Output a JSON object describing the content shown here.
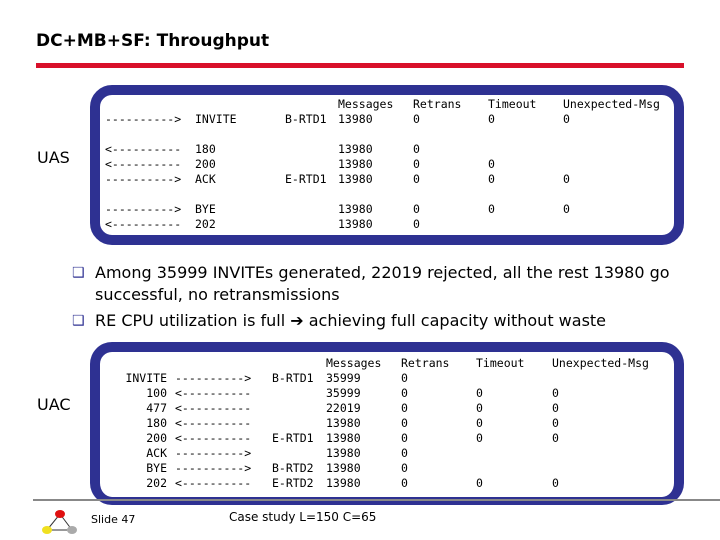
{
  "title": "DC+MB+SF: Throughput",
  "uas": {
    "label": "UAS",
    "header": [
      "Messages",
      "Retrans",
      "Timeout",
      "Unexpected-Msg"
    ],
    "rows": [
      {
        "arrow": "---------->",
        "msg": "INVITE",
        "rtd": "B-RTD1",
        "messages": "13980",
        "retrans": "0",
        "timeout": "0",
        "unexpected": "0"
      },
      {
        "arrow": "<----------",
        "msg": "180",
        "rtd": "",
        "messages": "13980",
        "retrans": "0",
        "timeout": "",
        "unexpected": ""
      },
      {
        "arrow": "<----------",
        "msg": "200",
        "rtd": "",
        "messages": "13980",
        "retrans": "0",
        "timeout": "0",
        "unexpected": ""
      },
      {
        "arrow": "---------->",
        "msg": "ACK",
        "rtd": "E-RTD1",
        "messages": "13980",
        "retrans": "0",
        "timeout": "0",
        "unexpected": "0"
      },
      {
        "arrow": "---------->",
        "msg": "BYE",
        "rtd": "",
        "messages": "13980",
        "retrans": "0",
        "timeout": "0",
        "unexpected": "0"
      },
      {
        "arrow": "<----------",
        "msg": "202",
        "rtd": "",
        "messages": "13980",
        "retrans": "0",
        "timeout": "",
        "unexpected": ""
      }
    ]
  },
  "bullets": [
    "Among 35999 INVITEs generated, 22019 rejected, all the rest 13980 go successful, no retransmissions",
    "RE CPU utilization is full ➔ achieving full capacity without waste"
  ],
  "uac": {
    "label": "UAC",
    "header": [
      "Messages",
      "Retrans",
      "Timeout",
      "Unexpected-Msg"
    ],
    "rows": [
      {
        "msg": "INVITE",
        "arrow": "---------->",
        "rtd": "B-RTD1",
        "messages": "35999",
        "retrans": "0",
        "timeout": "",
        "unexpected": ""
      },
      {
        "msg": "100",
        "arrow": "<----------",
        "rtd": "",
        "messages": "35999",
        "retrans": "0",
        "timeout": "0",
        "unexpected": "0"
      },
      {
        "msg": "477",
        "arrow": "<----------",
        "rtd": "",
        "messages": "22019",
        "retrans": "0",
        "timeout": "0",
        "unexpected": "0"
      },
      {
        "msg": "180",
        "arrow": "<----------",
        "rtd": "",
        "messages": "13980",
        "retrans": "0",
        "timeout": "0",
        "unexpected": "0"
      },
      {
        "msg": "200",
        "arrow": "<----------",
        "rtd": "E-RTD1",
        "messages": "13980",
        "retrans": "0",
        "timeout": "0",
        "unexpected": "0"
      },
      {
        "msg": "ACK",
        "arrow": "---------->",
        "rtd": "",
        "messages": "13980",
        "retrans": "0",
        "timeout": "",
        "unexpected": ""
      },
      {
        "msg": "BYE",
        "arrow": "---------->",
        "rtd": "B-RTD2",
        "messages": "13980",
        "retrans": "0",
        "timeout": "",
        "unexpected": ""
      },
      {
        "msg": "202",
        "arrow": "<----------",
        "rtd": "E-RTD2",
        "messages": "13980",
        "retrans": "0",
        "timeout": "0",
        "unexpected": "0"
      }
    ]
  },
  "footer": {
    "slide": "Slide 47",
    "case": "Case study L=150 C=65"
  },
  "colors": {
    "accent_red": "#d8102a",
    "box_border": "#2e3192"
  }
}
